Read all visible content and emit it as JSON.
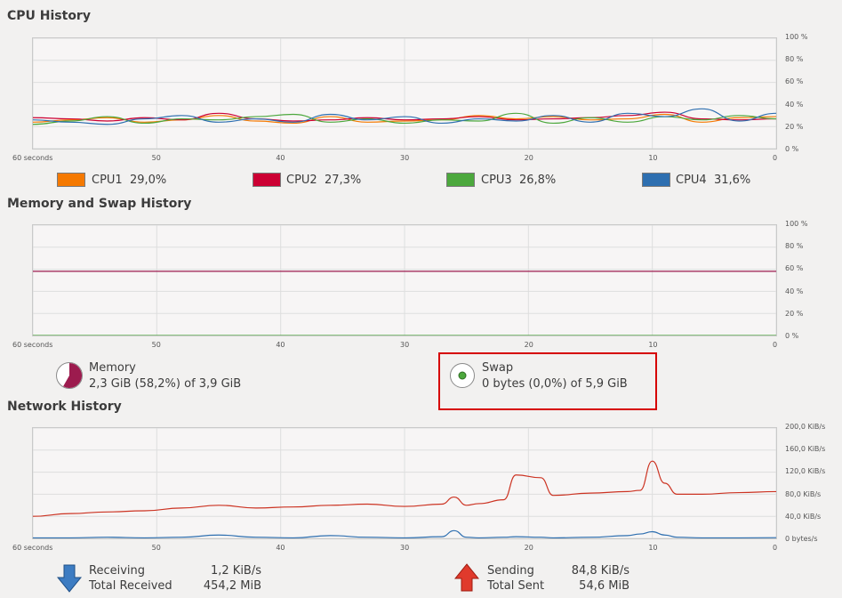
{
  "cpu": {
    "title": "CPU History",
    "y_ticks": [
      "100 %",
      "80 %",
      "60 %",
      "40 %",
      "20 %",
      "0 %"
    ],
    "x_ticks": [
      "60 seconds",
      "50",
      "40",
      "30",
      "20",
      "10",
      "0"
    ],
    "legend": [
      {
        "label": "CPU1",
        "value": "29,0%",
        "color": "#f57900"
      },
      {
        "label": "CPU2",
        "value": "27,3%",
        "color": "#cc0033"
      },
      {
        "label": "CPU3",
        "value": "26,8%",
        "color": "#4ca83d"
      },
      {
        "label": "CPU4",
        "value": "31,6%",
        "color": "#2e6fb0"
      }
    ]
  },
  "memory": {
    "title": "Memory and Swap History",
    "y_ticks": [
      "100 %",
      "80 %",
      "60 %",
      "40 %",
      "20 %",
      "0 %"
    ],
    "x_ticks": [
      "60 seconds",
      "50",
      "40",
      "30",
      "20",
      "10",
      "0"
    ],
    "memory_label": "Memory",
    "memory_value": "2,3 GiB (58,2%) of 3,9 GiB",
    "memory_percent": 58.2,
    "memory_color": "#9c1b4e",
    "swap_label": "Swap",
    "swap_value": "0 bytes (0,0%) of 5,9 GiB",
    "swap_percent": 0.0,
    "swap_color": "#4ca83d"
  },
  "network": {
    "title": "Network History",
    "y_ticks": [
      "200,0 KiB/s",
      "160,0 KiB/s",
      "120,0 KiB/s",
      "80,0 KiB/s",
      "40,0 KiB/s",
      "0 bytes/s"
    ],
    "x_ticks": [
      "60 seconds",
      "50",
      "40",
      "30",
      "20",
      "10",
      "0"
    ],
    "receiving_label": "Receiving",
    "receiving_value": "1,2 KiB/s",
    "total_received_label": "Total Received",
    "total_received_value": "454,2 MiB",
    "sending_label": "Sending",
    "sending_value": "84,8 KiB/s",
    "total_sent_label": "Total Sent",
    "total_sent_value": "54,6 MiB",
    "receiving_color": "#2e6fb0",
    "sending_color": "#cc3322"
  },
  "chart_data": [
    {
      "type": "line",
      "xlabel": "",
      "ylabel": "",
      "ylim": [
        0,
        100
      ],
      "xlim": [
        60,
        0
      ],
      "x": [
        60,
        57,
        54,
        51,
        48,
        45,
        42,
        39,
        36,
        33,
        30,
        27,
        24,
        21,
        18,
        15,
        12,
        9,
        6,
        3,
        0
      ],
      "series": [
        {
          "name": "CPU1",
          "values": [
            24,
            26,
            28,
            24,
            26,
            30,
            25,
            23,
            29,
            24,
            25,
            26,
            30,
            27,
            29,
            26,
            27,
            31,
            24,
            28,
            29
          ]
        },
        {
          "name": "CPU2",
          "values": [
            28,
            27,
            25,
            28,
            26,
            32,
            27,
            25,
            26,
            28,
            26,
            27,
            29,
            26,
            27,
            28,
            30,
            33,
            27,
            26,
            27
          ]
        },
        {
          "name": "CPU3",
          "values": [
            22,
            25,
            29,
            23,
            27,
            26,
            29,
            31,
            24,
            27,
            23,
            26,
            25,
            32,
            23,
            28,
            24,
            29,
            26,
            30,
            27
          ]
        },
        {
          "name": "CPU4",
          "values": [
            26,
            24,
            22,
            27,
            30,
            24,
            27,
            24,
            31,
            26,
            29,
            23,
            27,
            25,
            30,
            24,
            32,
            29,
            36,
            25,
            32
          ]
        }
      ]
    },
    {
      "type": "line",
      "xlabel": "",
      "ylabel": "",
      "ylim": [
        0,
        100
      ],
      "xlim": [
        60,
        0
      ],
      "x": [
        60,
        0
      ],
      "series": [
        {
          "name": "Memory",
          "values": [
            58.2,
            58.2
          ]
        },
        {
          "name": "Swap",
          "values": [
            0,
            0
          ]
        }
      ]
    },
    {
      "type": "line",
      "xlabel": "",
      "ylabel": "",
      "ylim": [
        0,
        200
      ],
      "xlim": [
        60,
        0
      ],
      "x": [
        60,
        57,
        54,
        51,
        48,
        45,
        42,
        39,
        36,
        33,
        30,
        27,
        26,
        25,
        24,
        22,
        21,
        19,
        18,
        15,
        12,
        11,
        10,
        9,
        8,
        6,
        3,
        0
      ],
      "series": [
        {
          "name": "Receiving",
          "values": [
            1,
            1,
            2,
            1,
            2,
            6,
            2,
            1,
            5,
            2,
            1,
            3,
            14,
            2,
            1,
            2,
            3,
            2,
            1,
            2,
            5,
            8,
            12,
            6,
            2,
            1,
            1,
            1.2
          ]
        },
        {
          "name": "Sending",
          "values": [
            40,
            45,
            48,
            50,
            55,
            60,
            55,
            57,
            60,
            62,
            58,
            62,
            75,
            60,
            63,
            70,
            115,
            110,
            78,
            82,
            85,
            87,
            140,
            100,
            80,
            80,
            83,
            84.8
          ]
        }
      ]
    }
  ]
}
